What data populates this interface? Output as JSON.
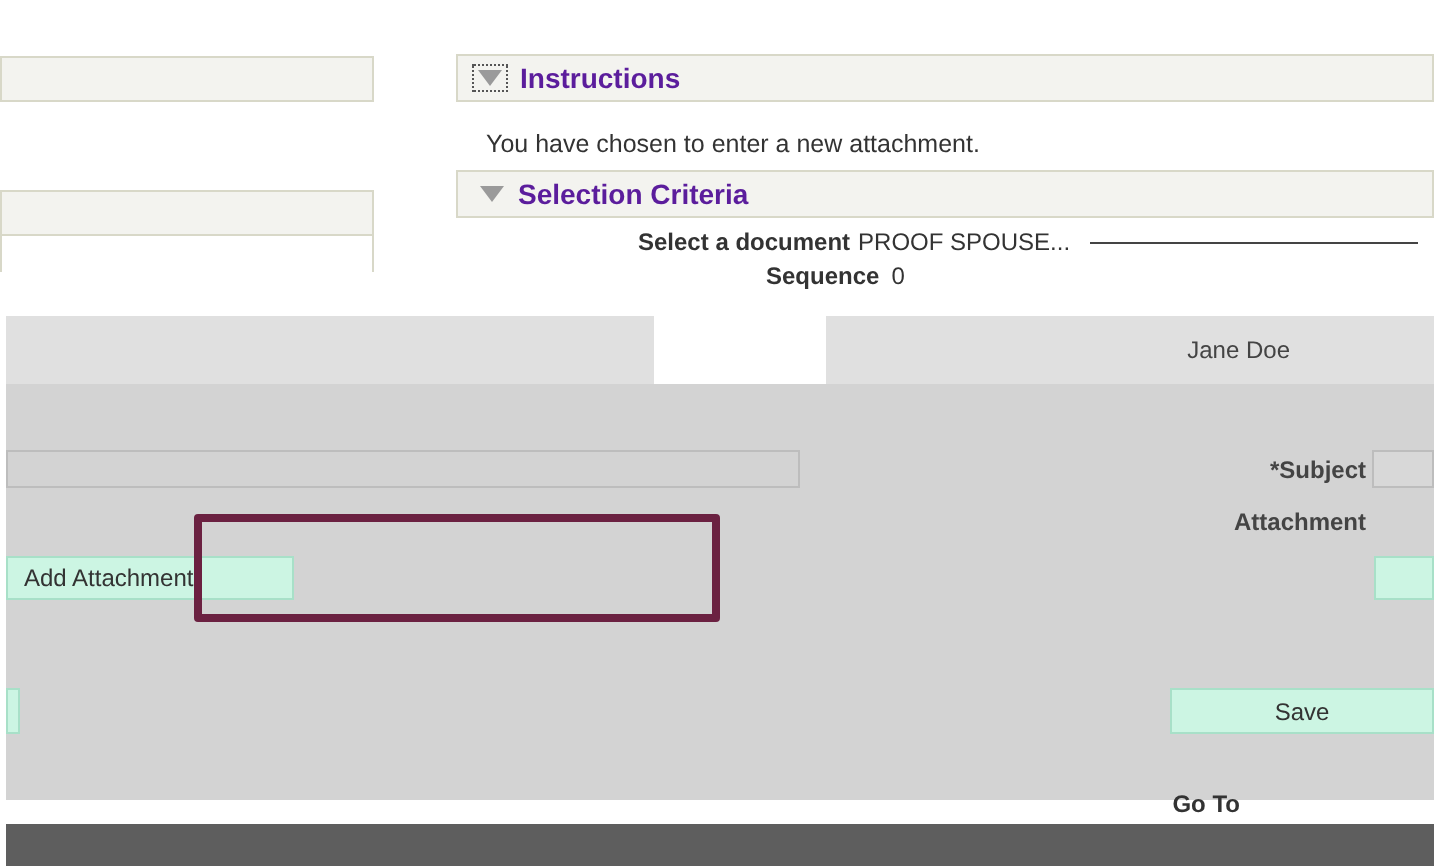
{
  "instructions": {
    "title": "Instructions",
    "expanded": true,
    "text": "You have chosen to enter a new attachment."
  },
  "selection_criteria": {
    "title": "Selection Criteria",
    "expanded": true,
    "document_label": "Select a document",
    "document_value": "PROOF SPOUSE...",
    "sequence_label": "Sequence",
    "sequence_value": "0"
  },
  "user_name": "Jane Doe",
  "form": {
    "subject_label": "*Subject",
    "attachment_label": "Attachment",
    "add_button": "Add Attachment",
    "save_button": "Save"
  },
  "footer": {
    "goto_label": "Go To"
  }
}
